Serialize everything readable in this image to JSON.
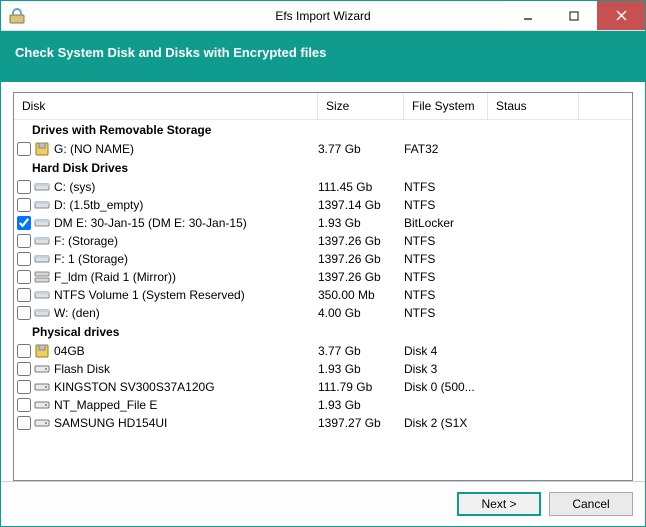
{
  "window": {
    "title": "Efs Import Wizard"
  },
  "header": {
    "title": "Check System Disk and Disks with Encrypted files"
  },
  "columns": {
    "disk": "Disk",
    "size": "Size",
    "fs": "File System",
    "status": "Staus"
  },
  "groups": [
    {
      "title": "Drives with Removable Storage",
      "items": [
        {
          "checked": false,
          "icon": "removable",
          "name": "G: (NO NAME)",
          "size": "3.77 Gb",
          "fs": "FAT32",
          "status": ""
        }
      ]
    },
    {
      "title": "Hard Disk Drives",
      "items": [
        {
          "checked": false,
          "icon": "hdd",
          "name": "C: (sys)",
          "size": "111.45 Gb",
          "fs": "NTFS",
          "status": ""
        },
        {
          "checked": false,
          "icon": "hdd",
          "name": "D: (1.5tb_empty)",
          "size": "1397.14 Gb",
          "fs": "NTFS",
          "status": ""
        },
        {
          "checked": true,
          "icon": "hdd",
          "name": "DM E: 30-Jan-15 (DM E: 30-Jan-15)",
          "size": "1.93 Gb",
          "fs": "BitLocker",
          "status": ""
        },
        {
          "checked": false,
          "icon": "hdd",
          "name": "F: (Storage)",
          "size": "1397.26 Gb",
          "fs": "NTFS",
          "status": ""
        },
        {
          "checked": false,
          "icon": "hdd",
          "name": "F: 1 (Storage)",
          "size": "1397.26 Gb",
          "fs": "NTFS",
          "status": ""
        },
        {
          "checked": false,
          "icon": "raid",
          "name": "F_ldm (Raid 1 (Mirror))",
          "size": "1397.26 Gb",
          "fs": "NTFS",
          "status": ""
        },
        {
          "checked": false,
          "icon": "hdd",
          "name": "NTFS Volume 1 (System Reserved)",
          "size": "350.00 Mb",
          "fs": "NTFS",
          "status": ""
        },
        {
          "checked": false,
          "icon": "hdd",
          "name": "W: (den)",
          "size": "4.00 Gb",
          "fs": "NTFS",
          "status": ""
        }
      ]
    },
    {
      "title": "Physical drives",
      "items": [
        {
          "checked": false,
          "icon": "removable",
          "name": "04GB",
          "size": "3.77 Gb",
          "fs": "Disk 4",
          "status": ""
        },
        {
          "checked": false,
          "icon": "phys",
          "name": "Flash Disk",
          "size": "1.93 Gb",
          "fs": "Disk 3",
          "status": ""
        },
        {
          "checked": false,
          "icon": "phys",
          "name": "KINGSTON SV300S37A120G",
          "size": "111.79 Gb",
          "fs": "Disk 0 (500...",
          "status": ""
        },
        {
          "checked": false,
          "icon": "phys",
          "name": "NT_Mapped_File E",
          "size": "1.93 Gb",
          "fs": "",
          "status": ""
        },
        {
          "checked": false,
          "icon": "phys",
          "name": "SAMSUNG HD154UI",
          "size": "1397.27 Gb",
          "fs": "Disk 2 (S1X",
          "status": ""
        }
      ]
    }
  ],
  "footer": {
    "next": "Next >",
    "cancel": "Cancel"
  }
}
